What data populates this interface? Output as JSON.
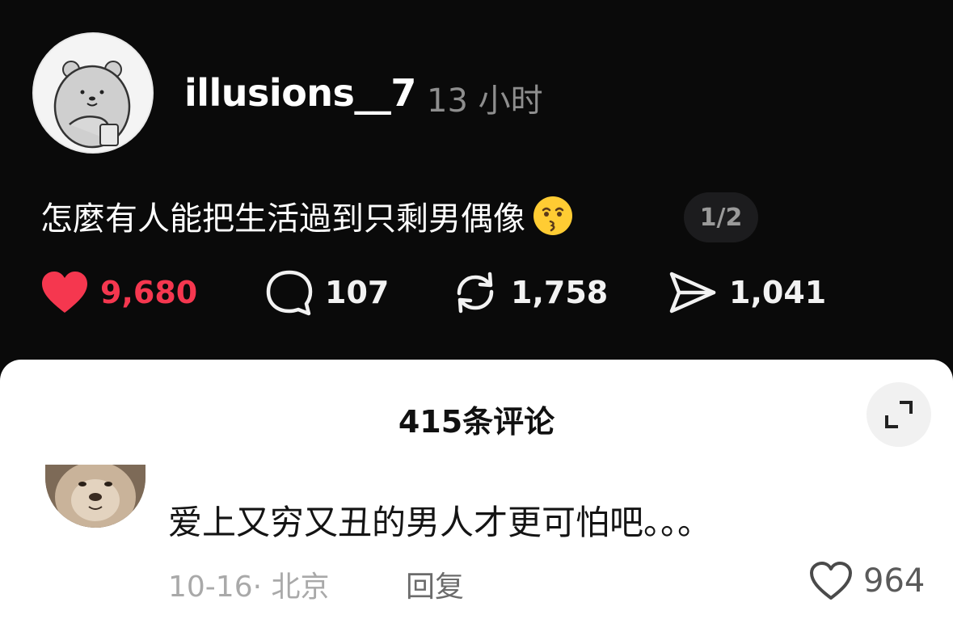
{
  "post": {
    "username": "illusions__7",
    "time": "13 小时",
    "text": "怎麼有人能把生活過到只剩男偶像",
    "emoji": "kissing-face-icon",
    "page_indicator": "1/2",
    "actions": {
      "likes": "9,680",
      "comments": "107",
      "reposts": "1,758",
      "shares": "1,041"
    },
    "like_color": "#f5374f"
  },
  "comments_sheet": {
    "title": "415条评论",
    "expand_icon": "expand-icon",
    "comments": [
      {
        "text": "爱上又穷又丑的男人才更可怕吧。。。",
        "meta": "10-16· 北京",
        "reply_label": "回复",
        "likes": "964"
      }
    ]
  }
}
